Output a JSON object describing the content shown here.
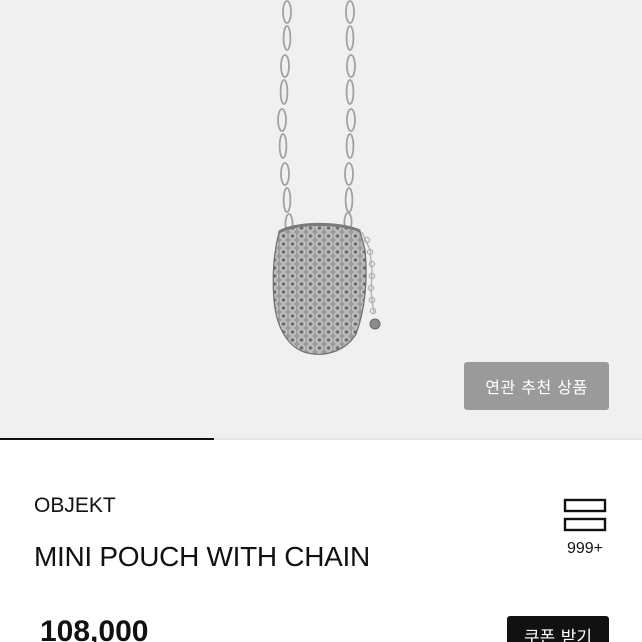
{
  "gallery": {
    "related_button_label": "연관 추천 상품",
    "image_icon": "chain-mesh-pouch-photo",
    "progress": 0.333,
    "colors": {
      "background": "#f0f0f0",
      "metal": "#8c8c8c",
      "progress": "#111111",
      "button": "#9a9a9a"
    }
  },
  "product": {
    "brand": "OBJEKT",
    "name": "MINI POUCH WITH CHAIN",
    "price": "108,000"
  },
  "list_widget": {
    "icon": "list-stack-icon",
    "count": "999+"
  },
  "coupon": {
    "label": "쿠폰 받기"
  }
}
